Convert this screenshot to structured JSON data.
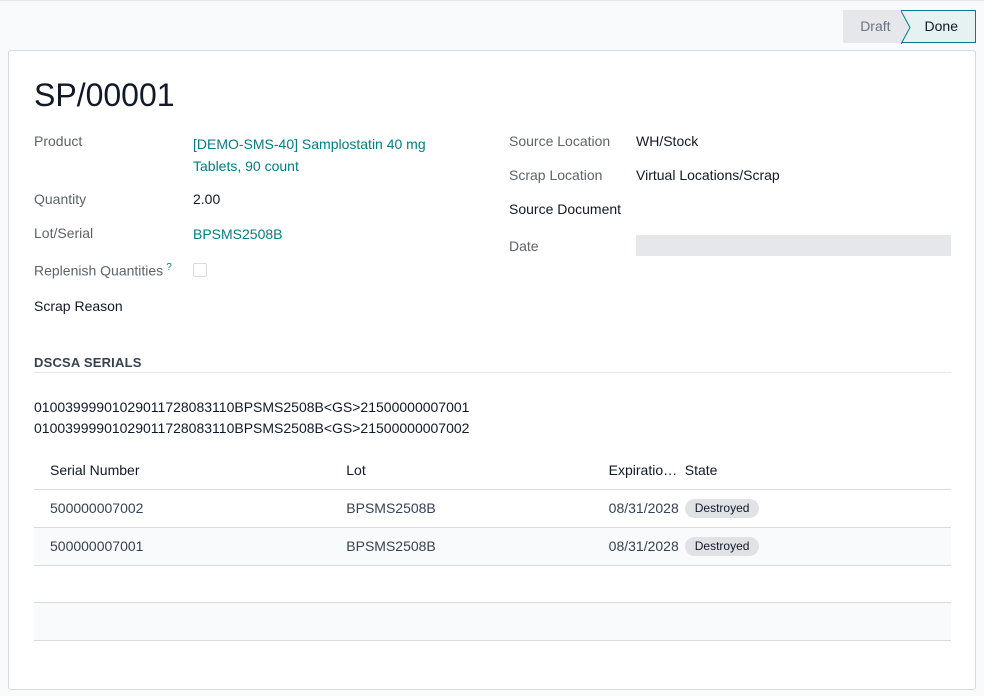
{
  "status": {
    "stages": [
      {
        "label": "Draft",
        "active": false
      },
      {
        "label": "Done",
        "active": true
      }
    ]
  },
  "record": {
    "title": "SP/00001"
  },
  "fields": {
    "product_label": "Product",
    "product_value_line1": "[DEMO-SMS-40] Samplostatin 40 mg",
    "product_value_line2": "Tablets, 90 count",
    "quantity_label": "Quantity",
    "quantity_value": "2.00",
    "lot_label": "Lot/Serial",
    "lot_value": "BPSMS2508B",
    "replenish_label": "Replenish Quantities",
    "replenish_help": "?",
    "replenish_checked": false,
    "scrap_reason_label": "Scrap Reason",
    "source_location_label": "Source Location",
    "source_location_value": "WH/Stock",
    "scrap_location_label": "Scrap Location",
    "scrap_location_value": "Virtual Locations/Scrap",
    "source_document_label": "Source Document",
    "date_label": "Date"
  },
  "dscsa": {
    "section_title": "DSCSA SERIALS",
    "serial_lines": [
      "01003999901029011728083110BPSMS2508B<GS>21500000007001",
      "01003999901029011728083110BPSMS2508B<GS>21500000007002"
    ]
  },
  "table": {
    "columns": [
      "Serial Number",
      "Lot",
      "Expiratio…",
      "State"
    ],
    "rows": [
      {
        "serial": "500000007002",
        "lot": "BPSMS2508B",
        "expiration": "08/31/2028",
        "state": "Destroyed"
      },
      {
        "serial": "500000007001",
        "lot": "BPSMS2508B",
        "expiration": "08/31/2028",
        "state": "Destroyed"
      }
    ]
  },
  "colors": {
    "accent": "#017e84",
    "border": "#d8dadd",
    "badge_bg": "#e0e2e6"
  }
}
